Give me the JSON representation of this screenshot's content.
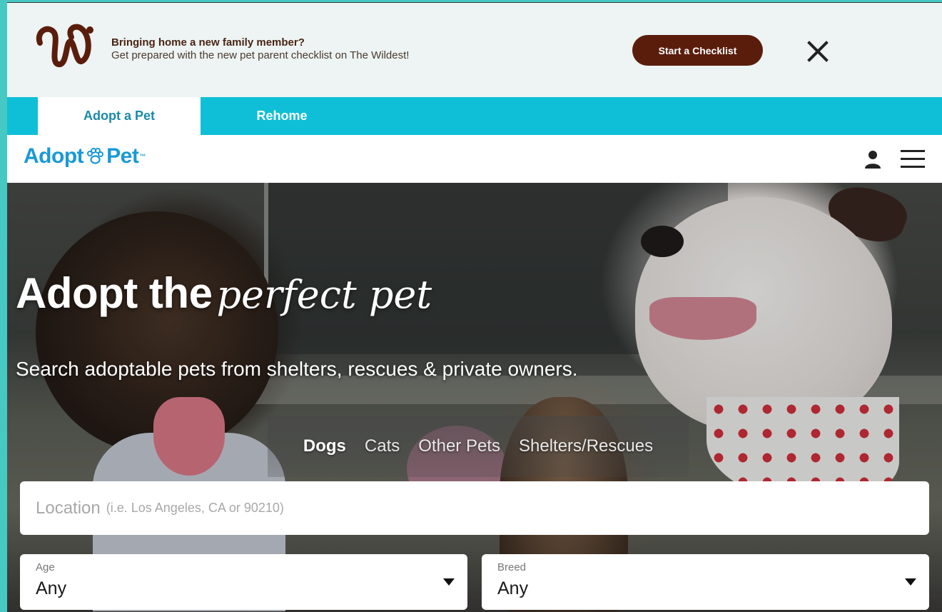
{
  "promo": {
    "headline": "Bringing home a new family member?",
    "subline": "Get prepared with the new pet parent checklist on The Wildest!",
    "cta_label": "Start a Checklist"
  },
  "tabs": [
    {
      "label": "Adopt a Pet",
      "active": true
    },
    {
      "label": "Rehome",
      "active": false
    }
  ],
  "header": {
    "brand_a": "Adopt",
    "brand_b": "Pet",
    "brand_tm": "™"
  },
  "hero": {
    "title_bold": "Adopt the",
    "title_script": "perfect pet",
    "subtitle": "Search adoptable pets from shelters, rescues & private owners.",
    "pet_tabs": [
      {
        "label": "Dogs",
        "active": true
      },
      {
        "label": "Cats",
        "active": false
      },
      {
        "label": "Other Pets",
        "active": false
      },
      {
        "label": "Shelters/Rescues",
        "active": false
      }
    ]
  },
  "search": {
    "location_placeholder": "Location",
    "location_hint": "(i.e. Los Angeles, CA or 90210)",
    "age_label": "Age",
    "age_value": "Any",
    "breed_label": "Breed",
    "breed_value": "Any"
  },
  "colors": {
    "page_border": "#46c9c3",
    "tab_bar": "#0fbfd8",
    "brand_blue": "#1a99d6",
    "cta_brown": "#5a1d0c"
  },
  "icons": {
    "promo_logo": "wildest-logo-icon",
    "close": "close-icon",
    "user": "user-icon",
    "menu": "hamburger-menu-icon",
    "caret": "caret-down-icon"
  }
}
